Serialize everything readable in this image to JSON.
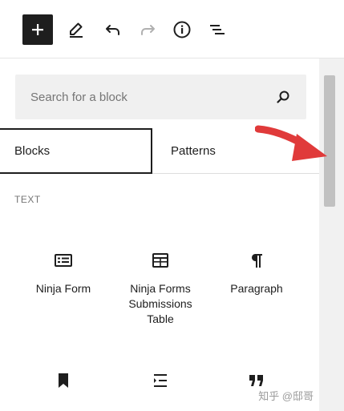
{
  "toolbar": {
    "add_icon": "plus-icon",
    "edit_icon": "pencil-icon",
    "undo_icon": "undo-icon",
    "redo_icon": "redo-icon",
    "info_icon": "info-icon",
    "list_icon": "list-view-icon"
  },
  "search": {
    "placeholder": "Search for a block",
    "value": ""
  },
  "tabs": [
    {
      "label": "Blocks",
      "selected": true
    },
    {
      "label": "Patterns",
      "selected": false
    }
  ],
  "section": {
    "label": "TEXT"
  },
  "blocks": [
    {
      "label": "Ninja Form",
      "icon": "form-icon"
    },
    {
      "label": "Ninja Forms Submissions Table",
      "icon": "table-icon"
    },
    {
      "label": "Paragraph",
      "icon": "paragraph-icon"
    },
    {
      "label": "",
      "icon": "bookmark-icon"
    },
    {
      "label": "",
      "icon": "indent-list-icon"
    },
    {
      "label": "",
      "icon": "quote-icon"
    }
  ],
  "annotation": {
    "color": "#e03a3a"
  },
  "watermark": {
    "text": "知乎 @邸哥"
  }
}
